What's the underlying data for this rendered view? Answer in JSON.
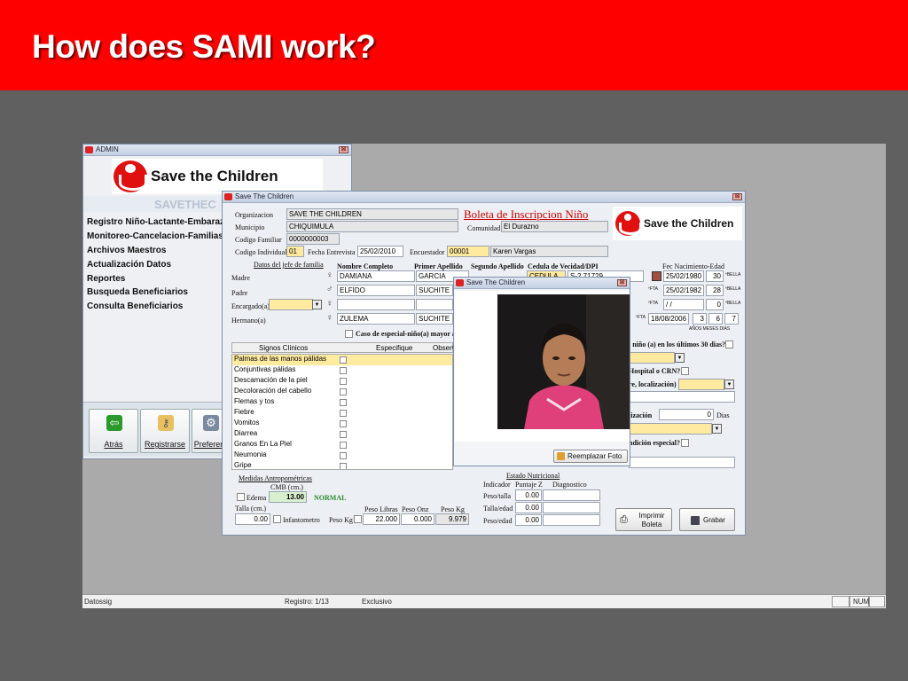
{
  "slide": {
    "title": "How does SAMI work?"
  },
  "admin_window": {
    "title": "ADMIN",
    "close": "⊠",
    "logo_text": "Save the Children",
    "logo_sub": "SAVETHEC",
    "menu": [
      "Registro Niño-Lactante-Embaraz",
      "Monitoreo-Cancelacion-Familias",
      "Archivos Maestros",
      "Actualización Datos",
      "Reportes",
      "Busqueda Beneficiarios",
      "Consulta Beneficiarios"
    ],
    "buttons": {
      "back": "Atrás",
      "register": "Registrarse",
      "prefs": "Preferen"
    }
  },
  "form": {
    "title": "Save The Children",
    "close": "⊠",
    "heading": "Boleta de Inscripcion Niño",
    "logo_text": "Save the Children",
    "labels": {
      "organizacion": "Organizacion",
      "municipio": "Municipio",
      "codigo_familiar": "Codigo Familiar",
      "codigo_individual": "Codigo Individual",
      "fecha_entrevista": "Fecha Entrevista",
      "encuestador": "Encuestador",
      "comunidad": "Comunidad",
      "datos_jefe": "Datos del jefe de familia",
      "nombre_completo": "Nombre Completo",
      "primer_apellido": "Primer Apellido",
      "segundo_apellido": "Segundo Apellido",
      "cedula": "Cedula de Vecidad/DPI",
      "fec_nac_edad": "Fec Nacimiento-Edad",
      "madre": "Madre",
      "padre": "Padre",
      "encargado": "Encargado(a)",
      "hermano": "Hermano(a)",
      "anos_meses_dias": "AÑOS MESES DIAS",
      "caso_especial": "Caso de especial-niño(a) mayor a 6",
      "q_30_dias": "l niño (a) en los últimos 30 dias?",
      "q_hospital": "Hospital o CRN?",
      "q_localizacion": "re, localización)",
      "q_lizacion": "lización",
      "dias": "Dias",
      "q_condicion": "ndición especial?"
    },
    "values": {
      "organizacion": "SAVE THE CHILDREN",
      "municipio": "CHIQUIMULA",
      "codigo_familiar": "0000000003",
      "codigo_individual": "01",
      "fecha_entrevista": "25/02/2010",
      "encuestador_code": "00001",
      "encuestador_name": "Karen Vargas",
      "comunidad": "El Durazno",
      "madre_nombre": "DAMIANA",
      "madre_apellido": "GARCIA",
      "madre_cedula_tipo": "CEDULA",
      "madre_cedula": "S-2  71729",
      "madre_fecha": "25/02/1980",
      "madre_edad": "30",
      "padre_nombre": "ELFIDO",
      "padre_apellido": "SUCHITE",
      "padre_fecha": "25/02/1982",
      "padre_edad": "28",
      "encargado_fecha": "/  /",
      "encargado_edad": "0",
      "hermano_nombre": "ZULEMA",
      "hermano_apellido": "SUCHITE",
      "hermano_fecha": "18/08/2006",
      "hermano_anos": "3",
      "hermano_meses": "6",
      "hermano_dias": "7",
      "dias_value": "0",
      "tag_fecha": "ºFTA",
      "tag_edad": "ºBELLA"
    },
    "signos": {
      "headers": [
        "Signos Clínicos",
        "Especifique",
        "Observ"
      ],
      "items": [
        "Palmas de las manos pálidas",
        "Conjuntivas pálidas",
        "Descamación de la piel",
        "Decoloración del cabello",
        "Flemas y tos",
        "Fiebre",
        "Vomitos",
        "Diarrea",
        "Granos En La Piel",
        "Neumonia",
        "Gripe"
      ]
    },
    "medidas": {
      "title": "Medidas Antropométricas",
      "cmb_label": "CMB (cm.)",
      "edema": "Edema",
      "cmb_value": "13.00",
      "cmb_status": "NORMAL",
      "talla_label": "Talla (cm.)",
      "talla_value": "0.00",
      "infantometro": "Infantometro",
      "peso_kg_label": "Peso Kg",
      "peso_libras_label": "Peso Libras",
      "peso_onz_label": "Peso Onz",
      "peso_kg2_label": "Peso Kg",
      "peso_libras": "22.000",
      "peso_onz": "0.000",
      "peso_kg": "9.979"
    },
    "nutricion": {
      "title": "Estado Nutricional",
      "headers": [
        "Indicador",
        "Puntaje Z",
        "Diagnostico"
      ],
      "rows": [
        {
          "label": "Peso/talla",
          "value": "0.00"
        },
        {
          "label": "Talla/edad",
          "value": "0.00"
        },
        {
          "label": "Peso/edad",
          "value": "0.00"
        }
      ]
    },
    "buttons": {
      "print": "Imprimir Boleta",
      "save": "Grabar"
    }
  },
  "photo_dialog": {
    "title": "Save The Children",
    "close": "⊠",
    "replace_button": "Reemplazar Foto"
  },
  "statusbar": {
    "app": "Datossig",
    "registro": "Registro: 1/13",
    "mode": "Exclusivo",
    "num": "NUM"
  },
  "colors": {
    "header_red": "#ff0000",
    "highlight_yellow": "#ffeaa0",
    "heading_red": "#cc0000"
  }
}
